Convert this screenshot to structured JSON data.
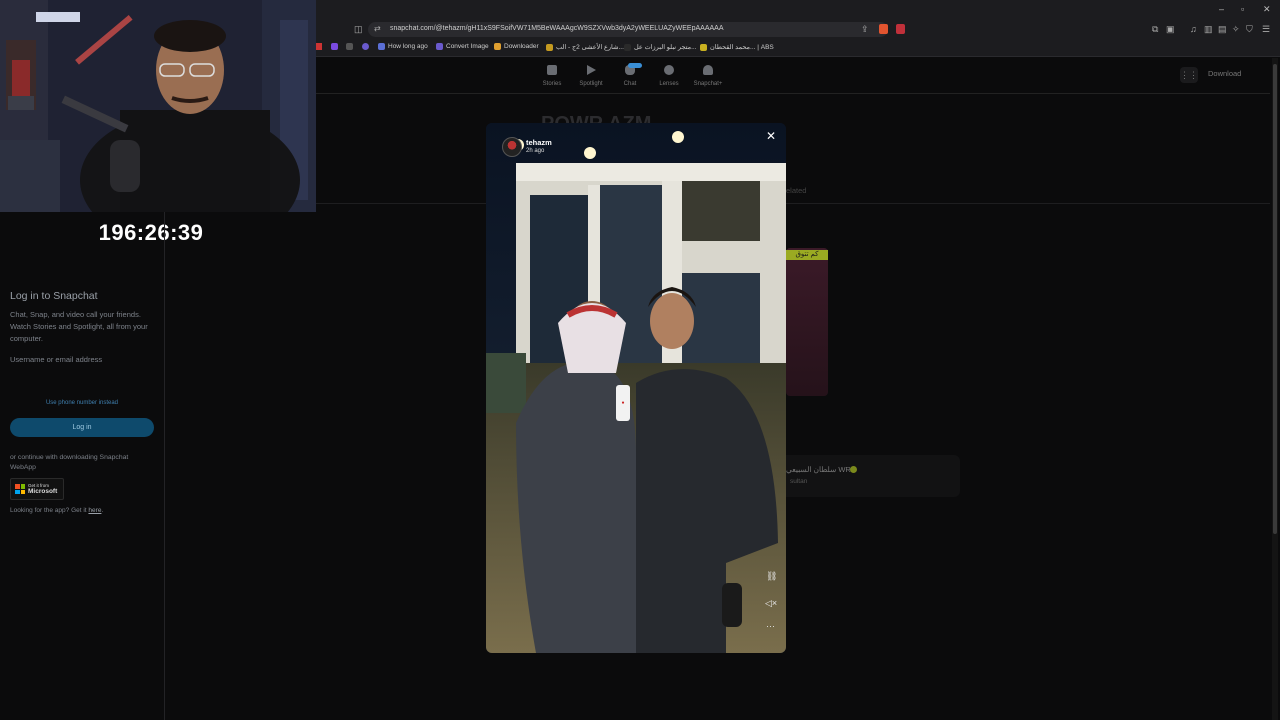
{
  "browser": {
    "url": "snapchat.com/@tehazm/gH11xS9FSoifVW71M5BeWAAAgcW9SZXVwb3dyA2yWEELUAZyWEEpAAAAAA",
    "window_controls": [
      "–",
      "▫",
      "✕"
    ],
    "bookmarks": [
      {
        "label": "How long ago",
        "color": "#5b6fd6"
      },
      {
        "label": "Convert Image",
        "color": "#6a5acd"
      },
      {
        "label": "Downloader",
        "color": "#e0a030"
      },
      {
        "label": "شارع الأعشى 2ج - الب...",
        "color": "#c49a20"
      },
      {
        "label": "متجر نبلو البرزات عل...",
        "color": "#2a2a2a"
      },
      {
        "label": "محمد القحطان... | ABS",
        "color": "#c8b020"
      }
    ]
  },
  "stream": {
    "timer": "196:26:39"
  },
  "login_panel": {
    "title": "Log in to Snapchat",
    "subtitle": "Chat, Snap, and video call your friends. Watch Stories and Spotlight, all from your computer.",
    "username_label": "Username or email address",
    "phone_link": "Use phone number instead",
    "login_button": "Log in",
    "download_text": "or continue with downloading Snapchat WebApp",
    "ms_small": "Get it from",
    "ms_big": "Microsoft",
    "footer_text": "Looking for the app? Get it",
    "footer_link": "here"
  },
  "snap_nav": {
    "items": [
      "Stories",
      "Spotlight",
      "Chat",
      "Lenses",
      "Snapchat+"
    ],
    "download": "Download"
  },
  "background_profile": {
    "name": "POWR AZM",
    "tab_related": "elated",
    "thumb_caption": "كم تتوق",
    "card_name": "سلطان السبيعي WR",
    "card_username": "sultan"
  },
  "story_modal": {
    "username": "tehazm",
    "time_ago": "2h ago",
    "close_icon": "close-icon",
    "controls": [
      "link-icon",
      "mute-icon",
      "more-icon"
    ]
  }
}
